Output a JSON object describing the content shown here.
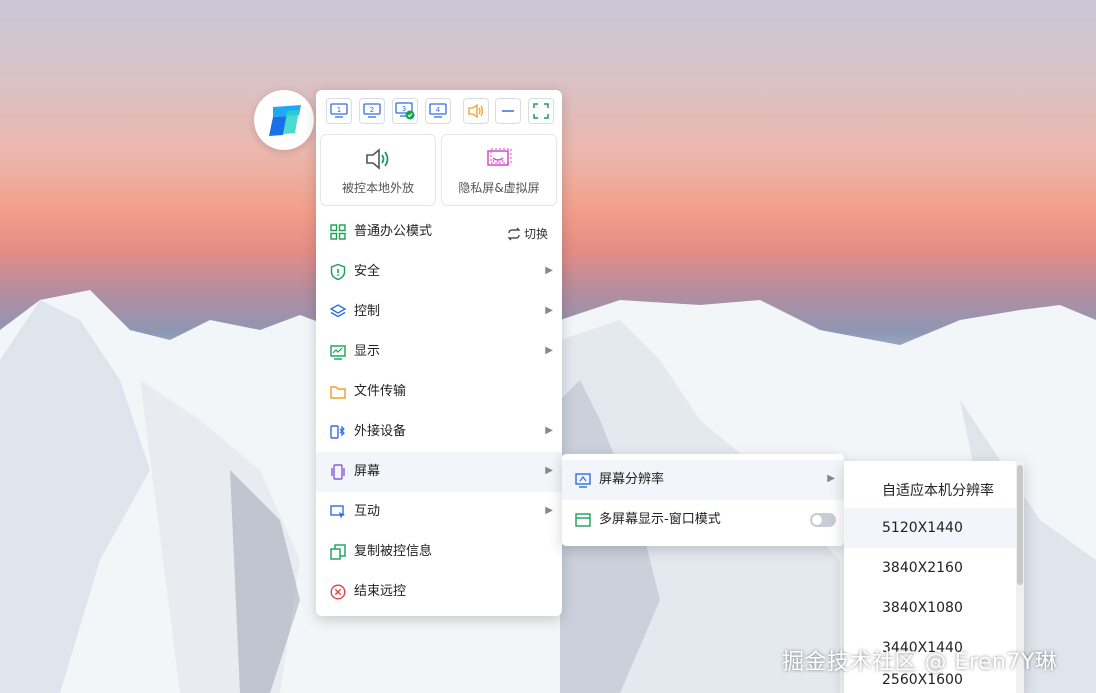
{
  "toolbar": {
    "screens": [
      "1",
      "2",
      "3",
      "4"
    ],
    "icons": [
      "monitor-1-icon",
      "monitor-2-icon",
      "monitor-3-active-icon",
      "monitor-4-icon",
      "speaker-icon",
      "minimize-icon",
      "fullscreen-icon"
    ]
  },
  "tiles": [
    {
      "label": "被控本地外放",
      "icon": "speaker-icon"
    },
    {
      "label": "隐私屏&虚拟屏",
      "icon": "privacy-screen-icon"
    }
  ],
  "menu": {
    "items": [
      {
        "label": "普通办公模式",
        "icon": "grid-icon",
        "extra": "切换"
      },
      {
        "label": "安全",
        "icon": "shield-icon"
      },
      {
        "label": "控制",
        "icon": "layers-icon"
      },
      {
        "label": "显示",
        "icon": "display-icon"
      },
      {
        "label": "文件传输",
        "icon": "folder-icon"
      },
      {
        "label": "外接设备",
        "icon": "bluetooth-device-icon"
      },
      {
        "label": "屏幕",
        "icon": "screen-icon"
      },
      {
        "label": "互动",
        "icon": "interact-icon"
      },
      {
        "label": "复制被控信息",
        "icon": "copy-icon"
      },
      {
        "label": "结束远控",
        "icon": "close-circle-icon"
      }
    ]
  },
  "submenu": {
    "items": [
      {
        "label": "屏幕分辨率",
        "icon": "resolution-icon"
      },
      {
        "label": "多屏幕显示-窗口模式",
        "icon": "window-icon"
      }
    ]
  },
  "resolutions": [
    "自适应本机分辨率",
    "5120X1440",
    "3840X2160",
    "3840X1080",
    "3440X1440",
    "2560X1600"
  ],
  "watermark": "掘金技术社区 @ Eren7Y琳",
  "colors": {
    "accent": "#2f6fe0",
    "green": "#18a058",
    "panel": "#ffffff"
  }
}
